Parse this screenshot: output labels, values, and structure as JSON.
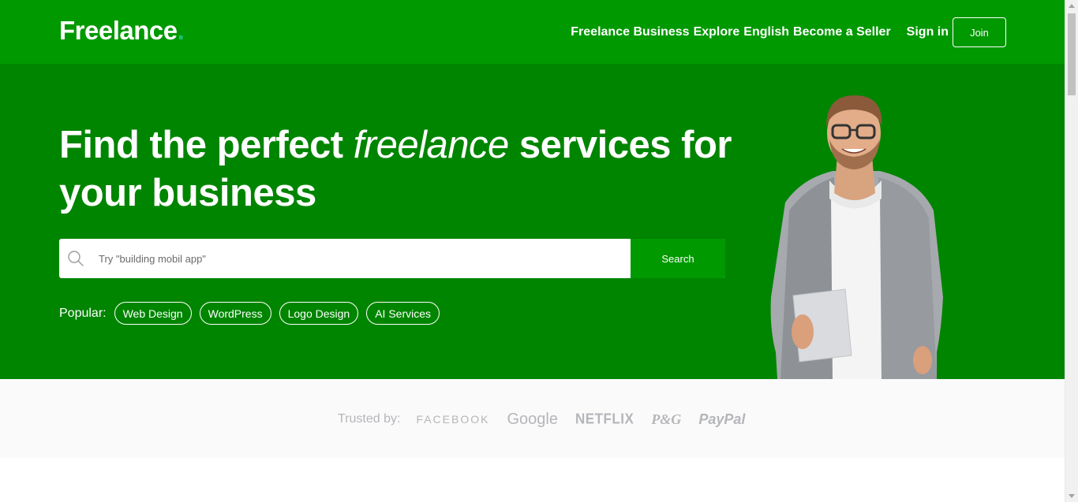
{
  "navbar": {
    "logo": "Freelance",
    "logo_dot": ".",
    "links": {
      "business": "Freelance Business",
      "explore": "Explore",
      "english": "English",
      "seller": "Become a Seller",
      "signin": "Sign in"
    },
    "join_label": "Join"
  },
  "hero": {
    "title_part1": "Find the perfect ",
    "title_italic": "freelance",
    "title_part2": " services for your business",
    "search": {
      "placeholder": "Try \"building mobil app\"",
      "value": "",
      "button_label": "Search",
      "icon": "search-icon"
    },
    "popular": {
      "label": "Popular:",
      "tags": [
        "Web Design",
        "WordPress",
        "Logo Design",
        "AI Services"
      ]
    }
  },
  "trusted": {
    "label": "Trusted by:",
    "brands": [
      "FACEBOOK",
      "Google",
      "NETFLIX",
      "P&G",
      "PayPal"
    ]
  },
  "colors": {
    "nav_bg": "#009900",
    "hero_bg": "#008500",
    "accent_dot": "#1dbf73",
    "trusted_bg": "#fafafa",
    "brand_gray": "#b5b6ba"
  }
}
